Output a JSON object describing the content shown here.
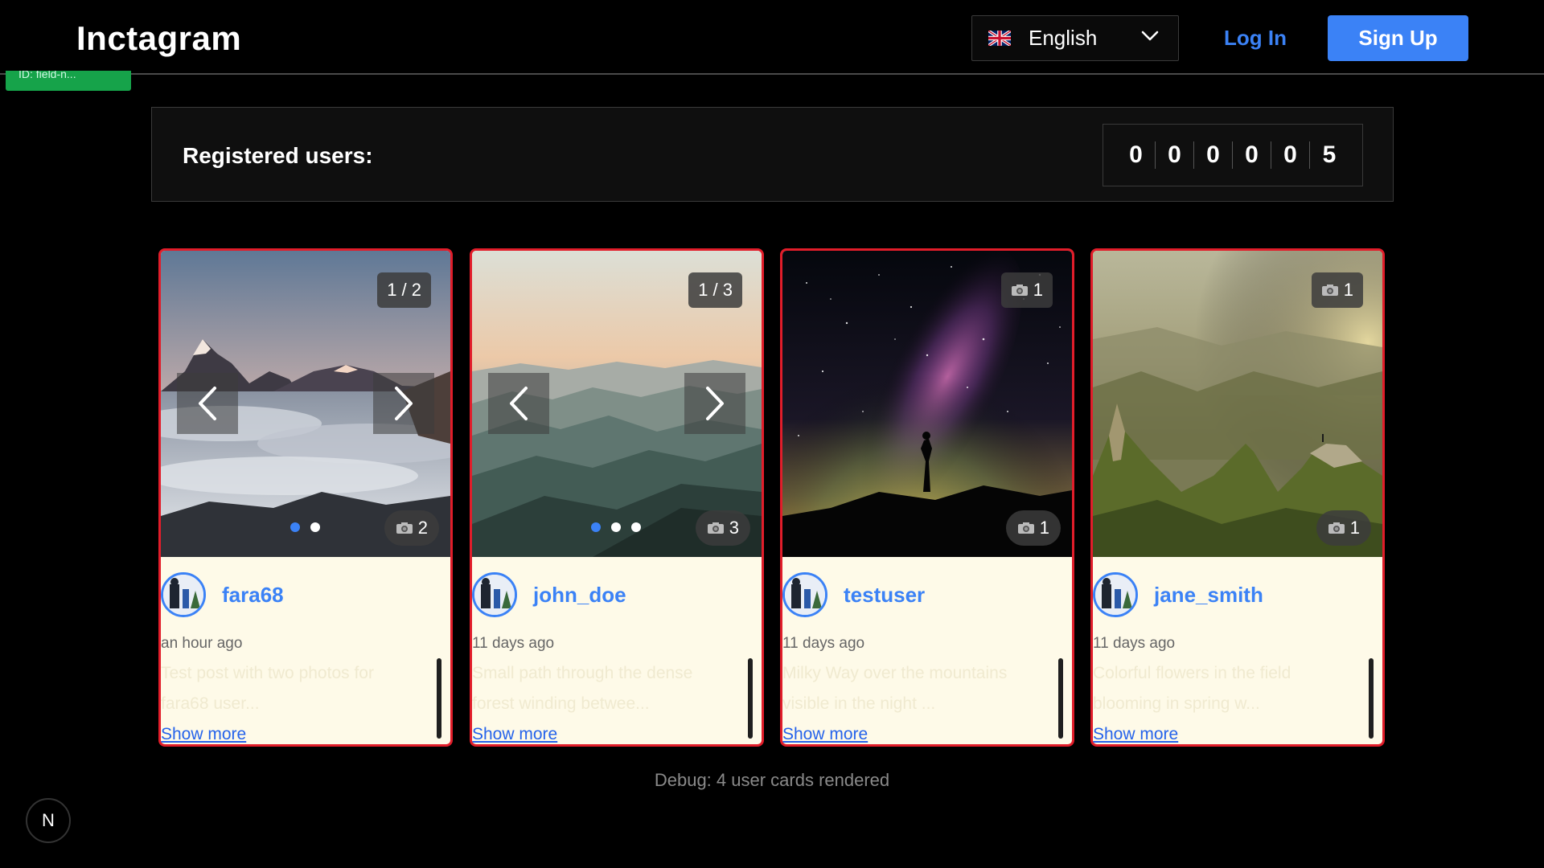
{
  "header": {
    "logo": "Inctagram",
    "language": "English",
    "login_label": "Log In",
    "signup_label": "Sign Up",
    "dev_tag": "ID: field-n..."
  },
  "registered": {
    "label": "Registered users:",
    "digits": [
      "0",
      "0",
      "0",
      "0",
      "0",
      "5"
    ]
  },
  "cards": [
    {
      "username": "fara68",
      "time": "an hour ago",
      "description": "Test post with two photos for fara68 user...",
      "show_more": "Show more",
      "top_badge": "1 / 2",
      "bottom_count": "2",
      "has_nav": true,
      "dots": 2
    },
    {
      "username": "john_doe",
      "time": "11 days ago",
      "description": "Small path through the dense forest winding betwee...",
      "show_more": "Show more",
      "top_badge": "1 / 3",
      "bottom_count": "3",
      "has_nav": true,
      "dots": 3
    },
    {
      "username": "testuser",
      "time": "11 days ago",
      "description": "Milky Way over the mountains visible in the night ...",
      "show_more": "Show more",
      "top_badge": "1",
      "bottom_count": "1",
      "has_nav": false,
      "dots": 0
    },
    {
      "username": "jane_smith",
      "time": "11 days ago",
      "description": "Colorful flowers in the field blooming in spring w...",
      "show_more": "Show more",
      "top_badge": "1",
      "bottom_count": "1",
      "has_nav": false,
      "dots": 0
    }
  ],
  "debug": "Debug: 4 user cards rendered",
  "corner_badge": "N",
  "colors": {
    "accent": "#3b82f6",
    "card_border": "#e11d2a",
    "card_bg": "#fefae8",
    "dev_tag": "#16a34a"
  }
}
